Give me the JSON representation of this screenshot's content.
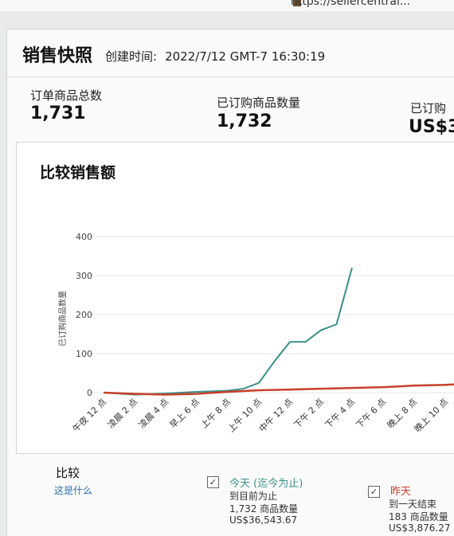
{
  "browser": {
    "url_fragment": "https://sellercentral..."
  },
  "snapshot": {
    "title": "销售快照",
    "created_label": "创建时间:",
    "created_value": "2022/7/12 GMT-7 16:30:19"
  },
  "stats": [
    {
      "label": "订单商品总数",
      "value": "1,731"
    },
    {
      "label": "已订购商品数量",
      "value": "1,732"
    },
    {
      "label": "已订购",
      "value": "US$3"
    }
  ],
  "chart_data": {
    "type": "line",
    "title": "比较销售额",
    "ylabel": "已订购商品数量",
    "ylim": [
      0,
      400
    ],
    "yticks": [
      "0",
      "100",
      "200",
      "300",
      "400"
    ],
    "categories": [
      "午夜 12 点",
      "凌晨 2 点",
      "凌晨 4 点",
      "早上 6 点",
      "上午 8 点",
      "上午 10 点",
      "中午 12 点",
      "下午 2 点",
      "下午 4 点",
      "下午 6 点",
      "晚上 8 点",
      "晚上 10 点"
    ],
    "series": [
      {
        "name": "今天 (迄今为止)",
        "color": "#3a8f8a",
        "x": [
          0,
          2,
          4,
          6,
          8,
          9,
          10,
          11,
          12,
          13,
          14,
          15,
          16
        ],
        "values": [
          0,
          -5,
          -2,
          2,
          5,
          10,
          25,
          80,
          130,
          130,
          160,
          175,
          320
        ]
      },
      {
        "name": "昨天",
        "color": "#c8402a",
        "x": [
          0,
          2,
          4,
          6,
          8,
          10,
          12,
          14,
          16,
          18,
          20,
          22,
          23
        ],
        "values": [
          0,
          -3,
          -5,
          -3,
          2,
          6,
          8,
          10,
          12,
          14,
          18,
          20,
          22
        ]
      }
    ]
  },
  "comparison": {
    "title": "比较",
    "link": "这是什么",
    "today": {
      "title": "今天 (迄今为止)",
      "sub1": "到目前为止",
      "sub2": "1,732 商品数量",
      "sub3": "US$36,543.67",
      "checked": "✓"
    },
    "yesterday": {
      "title": "昨天",
      "sub1": "到一天结束",
      "sub2": "183 商品数量",
      "sub3": "US$3,876.27",
      "checked": "✓"
    }
  }
}
